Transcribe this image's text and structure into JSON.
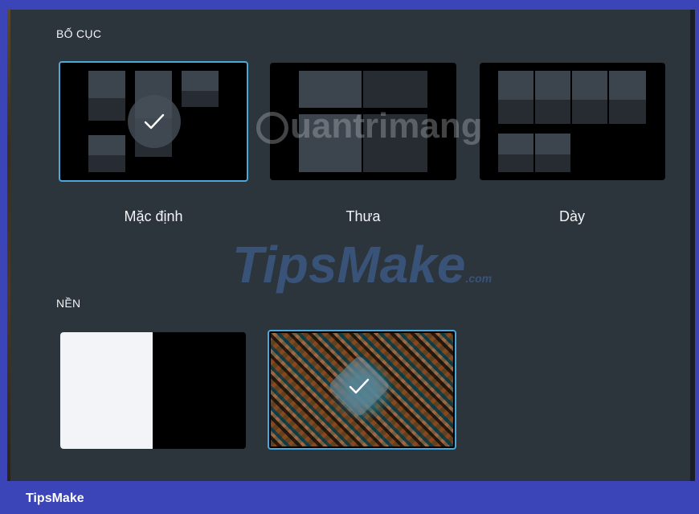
{
  "layout_section": {
    "title": "BỐ CỤC",
    "options": [
      {
        "label": "Mặc định",
        "selected": true
      },
      {
        "label": "Thưa",
        "selected": false
      },
      {
        "label": "Dày",
        "selected": false
      }
    ]
  },
  "background_section": {
    "title": "NỀN",
    "options": [
      {
        "name": "light-dark-split",
        "selected": false
      },
      {
        "name": "pattern-image",
        "selected": true
      }
    ]
  },
  "watermarks": {
    "quantrimang": "uantrimang",
    "tipsmake": "TipsMake",
    "tipsmake_suffix": ".com"
  },
  "footer": {
    "label": "TipsMake"
  },
  "colors": {
    "accent": "#4aa8dc",
    "panel": "#2c343c",
    "footer": "#3b45b8"
  }
}
